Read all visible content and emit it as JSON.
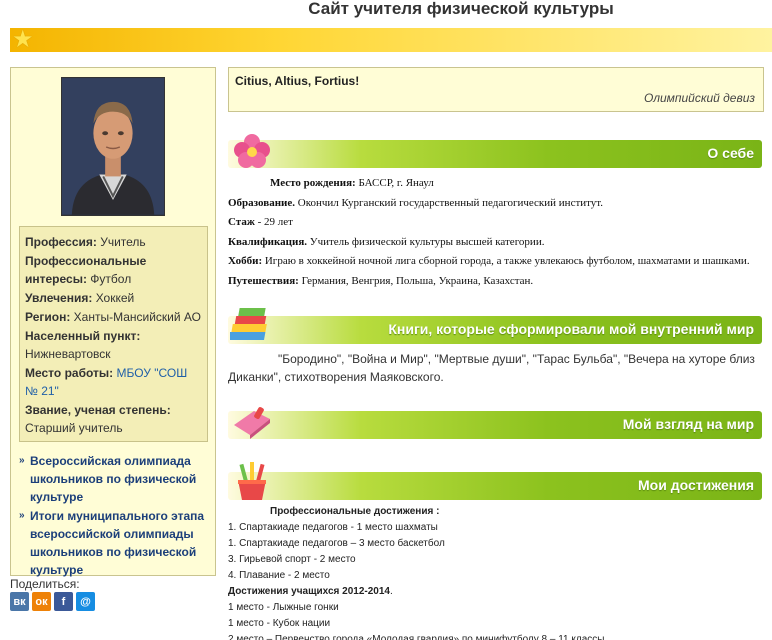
{
  "site": {
    "title": "Сайт учителя физической культуры"
  },
  "sidebar": {
    "info": [
      {
        "label": "Профессия:",
        "value": "Учитель",
        "is_link": false
      },
      {
        "label": "Профессиональные интересы:",
        "value": "Футбол",
        "is_link": false
      },
      {
        "label": "Увлечения:",
        "value": "Хоккей",
        "is_link": false
      },
      {
        "label": "Регион:",
        "value": "Ханты-Мансийский АО",
        "is_link": false
      },
      {
        "label": "Населенный пункт:",
        "value": "Нижневартовск",
        "is_link": false
      },
      {
        "label": "Место работы:",
        "value": "МБОУ \"СОШ № 21\"",
        "is_link": true
      },
      {
        "label": "Звание, ученая степень:",
        "value": "Старший учитель",
        "is_link": false
      }
    ],
    "links": [
      "Всероссийская олимпиада школьников по физической культуре",
      "Итоги муниципального этапа всероссийской олимпиады школьников по физической культуре"
    ],
    "share_label": "Поделиться:",
    "share_icons": [
      {
        "name": "vk-share-icon",
        "glyph": "вк"
      },
      {
        "name": "ok-share-icon",
        "glyph": "ок"
      },
      {
        "name": "facebook-share-icon",
        "glyph": "f"
      },
      {
        "name": "moimir-share-icon",
        "glyph": "@"
      }
    ]
  },
  "motto": {
    "text": "Citius, Altius, Fortius!",
    "source": "Олимпийский девиз"
  },
  "sections": {
    "about": {
      "title": "О себе",
      "rows": [
        {
          "label": "Место рождения:",
          "value": " БАССР, г. Янаул"
        },
        {
          "label": "Образование.",
          "value": " Окончил Курганский государственный педагогический институт."
        },
        {
          "label": "Стаж",
          "value": " - 29 лет"
        },
        {
          "label": "Квалификация.",
          "value": " Учитель физической культуры высшей категории."
        },
        {
          "label": "Хобби:",
          "value": " Играю в хоккейной ночной лига сборной города, а также увлекаюсь футболом, шахматами и шашками."
        },
        {
          "label": "Путешествия:",
          "value": " Германия, Венгрия, Польша, Украина, Казахстан."
        }
      ]
    },
    "books": {
      "title": "Книги, которые сформировали мой внутренний мир",
      "text": "\"Бородино\", \"Война и Мир\", \"Мертвые души\", \"Тарас Бульба\", \"Вечера на хуторе близ Диканки\", стихотворения Маяковского."
    },
    "worldview": {
      "title": "Мой взгляд на мир"
    },
    "achievements": {
      "title": "Мои достижения",
      "heading": "Профессиональные достижения :",
      "items": [
        "1. Спартакиаде педагогов - 1 место шахматы",
        "1. Спартакиаде педагогов – 3 место баскетбол",
        "3. Гирьевой спорт - 2 место",
        "4. Плавание - 2 место"
      ],
      "students_heading": "Достижения учащихся  2012-2014",
      "students_heading_tail": ".",
      "student_items": [
        "1 место - Лыжные гонки",
        "1 место - Кубок нации",
        "2 место – Первенство города  «Молодая гвардия» по минифутболу  8 – 11 классы"
      ]
    }
  },
  "colors": {
    "accent_green": "#8cc21e",
    "link_blue": "#1c3f7a",
    "panel_yellow": "#fffdd6"
  }
}
